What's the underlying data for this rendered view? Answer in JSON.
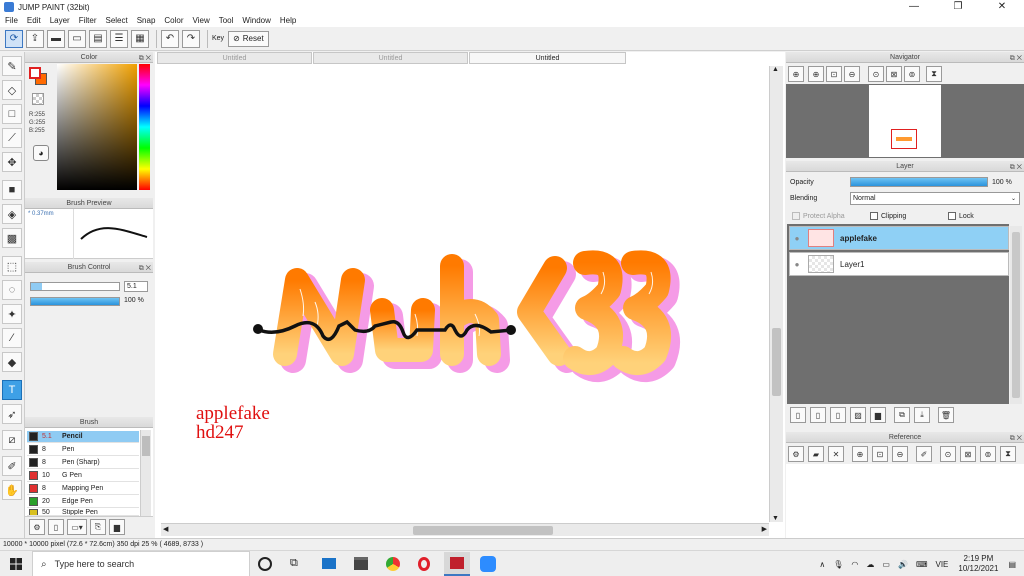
{
  "window": {
    "title": "JUMP PAINT (32bit)",
    "minimize": "—",
    "maximize": "❐",
    "close": "✕"
  },
  "menu": [
    "File",
    "Edit",
    "Layer",
    "Filter",
    "Select",
    "Snap",
    "Color",
    "View",
    "Tool",
    "Window",
    "Help"
  ],
  "toolbar": {
    "key_label": "Key",
    "reset_label": "Reset"
  },
  "panels": {
    "color": "Color",
    "brush_preview": "Brush Preview",
    "brush_control": "Brush Control",
    "brush": "Brush",
    "navigator": "Navigator",
    "layer": "Layer",
    "reference": "Reference"
  },
  "color": {
    "r": "R:255",
    "g": "G:255",
    "b": "B:255",
    "accent": "#ff6a00",
    "selection": "#3ea0e6"
  },
  "brush_preview": {
    "size": "* 0.37mm"
  },
  "brush_control": {
    "size_value": "5.1",
    "opacity_value": "100 %",
    "size": 0.13,
    "opacity": 1.0
  },
  "brushes": [
    {
      "size": "5.1",
      "name": "Pencil",
      "color": "#222222"
    },
    {
      "size": "8",
      "name": "Pen",
      "color": "#222222"
    },
    {
      "size": "8",
      "name": "Pen (Sharp)",
      "color": "#222222"
    },
    {
      "size": "10",
      "name": "G Pen",
      "color": "#e03030"
    },
    {
      "size": "8",
      "name": "Mapping Pen",
      "color": "#e03030"
    },
    {
      "size": "20",
      "name": "Edge Pen",
      "color": "#2aa02a"
    },
    {
      "size": "50",
      "name": "Stipple Pen",
      "color": "#d8c020"
    }
  ],
  "documents": [
    "Untitled",
    "Untitled",
    "Untitled"
  ],
  "canvas": {
    "signature_line1": "applefake",
    "signature_line2": "hd247",
    "artwork_text": "Nuh<33"
  },
  "layer": {
    "opacity_label": "Opacity",
    "opacity_value": "100 %",
    "opacity": 1.0,
    "blending_label": "Blending",
    "blending_value": "Normal",
    "protect_alpha": "Protect Alpha",
    "clipping": "Clipping",
    "lock": "Lock",
    "layers": [
      {
        "name": "applefake"
      },
      {
        "name": "Layer1"
      }
    ]
  },
  "status": {
    "info": "10000 * 10000 pixel  (72.6 * 72.6cm)  350 dpi  25 %  ( 4689, 8733 )"
  },
  "taskbar": {
    "search_placeholder": "Type here to search",
    "language": "VIE",
    "time": "2:19 PM",
    "date": "10/12/2021"
  }
}
